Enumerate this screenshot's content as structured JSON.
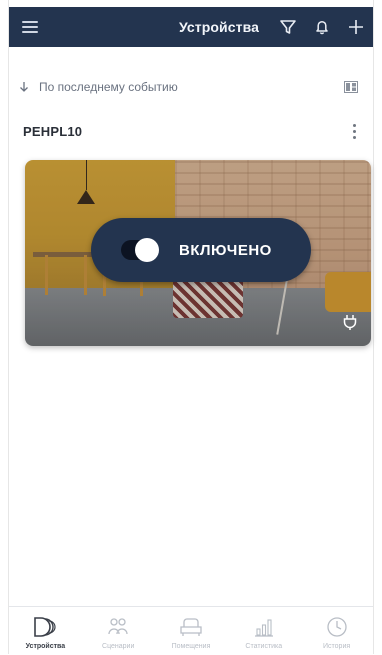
{
  "header": {
    "title": "Устройства",
    "menu_icon": "menu-icon",
    "filter_icon": "filter-icon",
    "bell_icon": "bell-icon",
    "add_icon": "plus-icon"
  },
  "sort": {
    "label": "По последнему событию",
    "arrow_icon": "arrow-down-icon",
    "view_icon": "grid-view-icon"
  },
  "device": {
    "name": "PEHPL10",
    "state_label": "ВКЛЮЧЕНО",
    "is_on": true,
    "type_icon": "plug-icon"
  },
  "bottom_nav": [
    {
      "label": "Устройства",
      "icon": "devices-icon",
      "active": true
    },
    {
      "label": "Сценарии",
      "icon": "scenes-icon",
      "active": false
    },
    {
      "label": "Помещения",
      "icon": "rooms-icon",
      "active": false
    },
    {
      "label": "Статистика",
      "icon": "stats-icon",
      "active": false
    },
    {
      "label": "История",
      "icon": "history-icon",
      "active": false
    }
  ],
  "colors": {
    "header_bg": "#23344f",
    "pill_bg": "#23344f",
    "text_dark": "#2a2f38"
  }
}
